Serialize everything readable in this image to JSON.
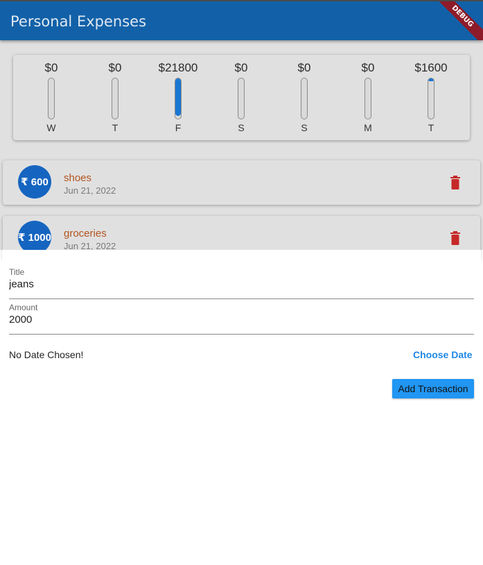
{
  "app": {
    "title": "Personal Expenses",
    "debug_banner": "DEBUG",
    "accent": "#1261a8"
  },
  "chart": {
    "bars": [
      {
        "amount": "$0",
        "day": "W",
        "fill_fraction": 0
      },
      {
        "amount": "$0",
        "day": "T",
        "fill_fraction": 0
      },
      {
        "amount": "$21800",
        "day": "F",
        "fill_fraction": 0.93
      },
      {
        "amount": "$0",
        "day": "S",
        "fill_fraction": 0
      },
      {
        "amount": "$0",
        "day": "S",
        "fill_fraction": 0
      },
      {
        "amount": "$0",
        "day": "M",
        "fill_fraction": 0
      },
      {
        "amount": "$1600",
        "day": "T",
        "fill_fraction": 0.07
      }
    ]
  },
  "transactions": [
    {
      "amount": "₹ 600",
      "title": "shoes",
      "date": "Jun 21, 2022",
      "delete_icon": "trash-icon"
    },
    {
      "amount": "₹ 1000",
      "title": "groceries",
      "date": "Jun 21, 2022",
      "delete_icon": "trash-icon"
    }
  ],
  "form": {
    "title_label": "Title",
    "title_value": "jeans",
    "amount_label": "Amount",
    "amount_value": "2000",
    "date_status": "No Date Chosen!",
    "choose_date_label": "Choose Date",
    "submit_label": "Add Transaction"
  }
}
